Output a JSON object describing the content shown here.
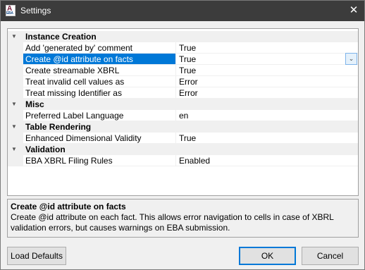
{
  "window": {
    "title": "Settings",
    "app_icon_letter": "A",
    "app_icon_text": "EBA",
    "close_glyph": "✕"
  },
  "grid": {
    "categories": [
      {
        "label": "Instance Creation",
        "expanded": true,
        "properties": [
          {
            "name": "Add 'generated by' comment",
            "value": "True"
          },
          {
            "name": "Create @id attribute on facts",
            "value": "True",
            "selected": true
          },
          {
            "name": "Create streamable XBRL",
            "value": "True"
          },
          {
            "name": "Treat invalid cell values as",
            "value": "Error"
          },
          {
            "name": "Treat missing Identifier as",
            "value": "Error"
          }
        ]
      },
      {
        "label": "Misc",
        "expanded": true,
        "properties": [
          {
            "name": "Preferred Label Language",
            "value": "en"
          }
        ]
      },
      {
        "label": "Table Rendering",
        "expanded": true,
        "properties": [
          {
            "name": "Enhanced Dimensional Validity",
            "value": "True"
          }
        ]
      },
      {
        "label": "Validation",
        "expanded": true,
        "properties": [
          {
            "name": "EBA XBRL Filing Rules",
            "value": "Enabled"
          }
        ]
      }
    ],
    "expand_glyph": "▼",
    "dropdown_glyph": "⌄"
  },
  "description": {
    "title": "Create @id attribute on facts",
    "text": "Create @id attribute on each fact. This allows error navigation to cells in case of XBRL validation errors, but causes warnings on EBA submission."
  },
  "buttons": {
    "load_defaults": "Load Defaults",
    "ok": "OK",
    "cancel": "Cancel"
  },
  "colors": {
    "selection": "#0078d7",
    "titlebar": "#3c3c3c"
  }
}
